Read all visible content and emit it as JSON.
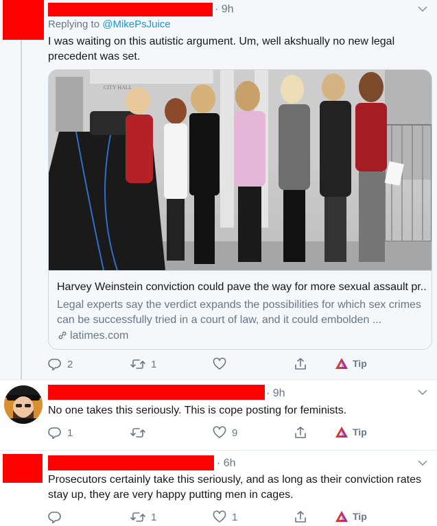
{
  "tweets": [
    {
      "time": "· 9h",
      "replying_label": "Replying to",
      "replying_handle": "@MikePsJuice",
      "text": "I was waiting on this autistic argument. Um, well akshually no new legal precedent was set.",
      "card": {
        "image_sign_text": "CITY HALL",
        "title": "Harvey Weinstein conviction could pave the way for more sexual assault pr...",
        "description": "Legal experts say the verdict expands the possibilities for which sex crimes can be successfully tried in a court of law, and it could embolden ...",
        "domain": "latimes.com"
      },
      "actions": {
        "reply_count": "2",
        "retweet_count": "1",
        "like_count": "",
        "tip_label": "Tip"
      }
    },
    {
      "time": "· 9h",
      "text": "No one takes this seriously. This is cope posting for feminists.",
      "actions": {
        "reply_count": "1",
        "retweet_count": "",
        "like_count": "9",
        "tip_label": "Tip"
      }
    },
    {
      "time": "· 6h",
      "text": "Prosecutors certainly take this seriously, and as long as their conviction rates stay up, they are very happy putting men in cages.",
      "actions": {
        "reply_count": "",
        "retweet_count": "1",
        "like_count": "1",
        "tip_label": "Tip"
      }
    }
  ],
  "colors": {
    "redaction": "#ff0000",
    "link_blue": "#1b95e0",
    "secondary_text": "#657786",
    "tip_red": "#e0332b",
    "thread_line": "#ccd6dd"
  },
  "icons": [
    "reply-icon",
    "retweet-icon",
    "like-icon",
    "share-icon",
    "tip-icon",
    "chevron-down-icon",
    "link-icon"
  ]
}
